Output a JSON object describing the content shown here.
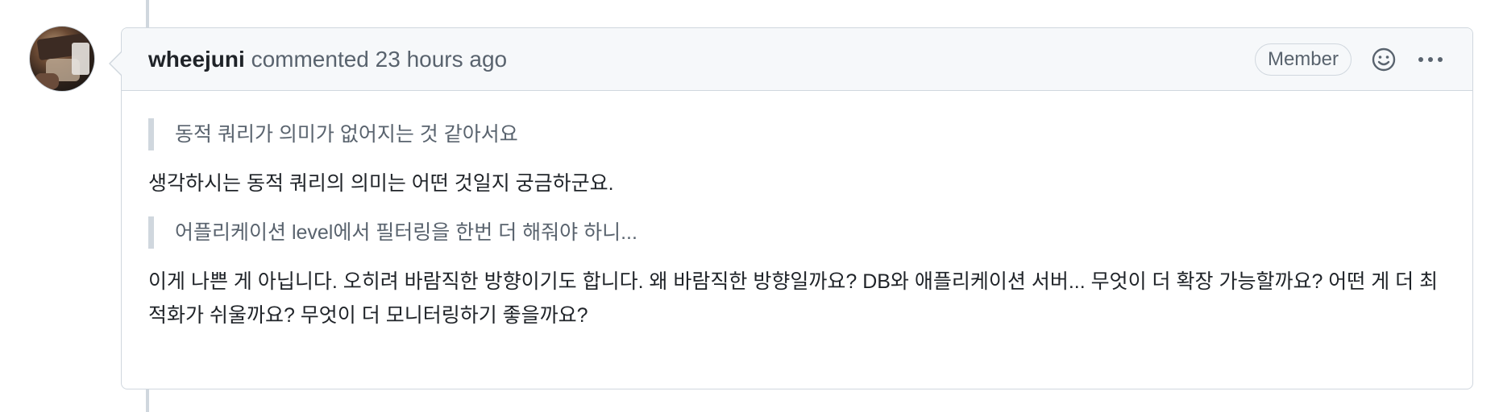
{
  "comment": {
    "author": "wheejuni",
    "action": "commented",
    "timestamp": "23 hours ago",
    "badge": "Member",
    "icons": {
      "avatar": "avatar-photo",
      "reaction": "smiley-icon",
      "menu": "kebab-horizontal-icon"
    },
    "body": {
      "quote1": "동적 쿼리가 의미가 없어지는 것 같아서요",
      "para1": "생각하시는 동적 쿼리의 의미는 어떤 것일지 궁금하군요.",
      "quote2": "어플리케이션 level에서 필터링을 한번 더 해줘야 하니...",
      "para2": "이게 나쁜 게 아닙니다. 오히려 바람직한 방향이기도 합니다. 왜 바람직한 방향일까요? DB와 애플리케이션 서버... 무엇이 더 확장 가능할까요? 어떤 게 더 최적화가 쉬울까요? 무엇이 더 모니터링하기 좋을까요?"
    }
  },
  "colors": {
    "header_bg": "#f6f8fa",
    "border": "#d0d7de",
    "muted_text": "#59636e",
    "text": "#1f2328"
  }
}
